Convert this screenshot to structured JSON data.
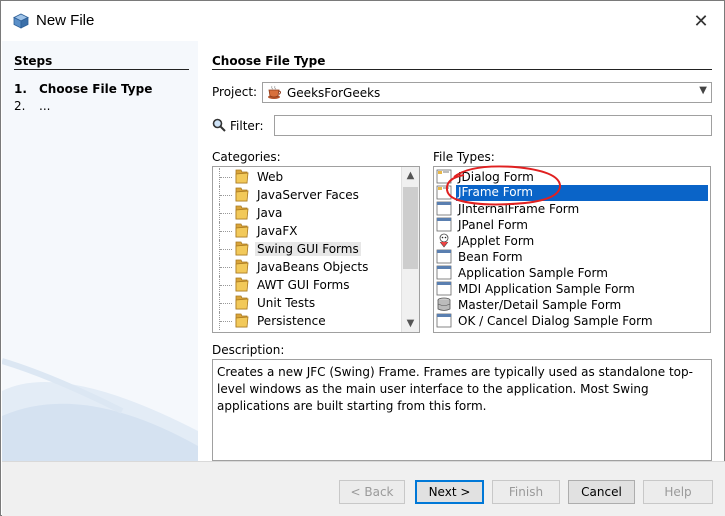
{
  "window": {
    "title": "New File",
    "close_glyph": "✕"
  },
  "steps": {
    "header": "Steps",
    "items": [
      {
        "num": "1.",
        "label": "Choose File Type"
      },
      {
        "num": "2.",
        "label": "..."
      }
    ]
  },
  "main": {
    "header": "Choose File Type",
    "project_label": "Project:",
    "project_value": "GeeksForGeeks",
    "filter_label": "Filter:",
    "filter_value": "",
    "categories_label": "Categories:",
    "file_types_label": "File Types:",
    "categories": [
      "Web",
      "JavaServer Faces",
      "Java",
      "JavaFX",
      "Swing GUI Forms",
      "JavaBeans Objects",
      "AWT GUI Forms",
      "Unit Tests",
      "Persistence"
    ],
    "selected_category": "Swing GUI Forms",
    "file_types": [
      "JDialog Form",
      "JFrame Form",
      "JInternalFrame Form",
      "JPanel Form",
      "JApplet Form",
      "Bean Form",
      "Application Sample Form",
      "MDI Application Sample Form",
      "Master/Detail Sample Form",
      "OK / Cancel Dialog Sample Form"
    ],
    "selected_file_type": "JFrame Form",
    "description_label": "Description:",
    "description_text": "Creates a new JFC (Swing) Frame. Frames are typically used as standalone top-level windows as the main user interface to the application. Most Swing applications are built starting from this form."
  },
  "buttons": {
    "back": "< Back",
    "next": "Next >",
    "finish": "Finish",
    "cancel": "Cancel",
    "help": "Help"
  },
  "colors": {
    "selection": "#0a64c8",
    "annotation_circle": "#e02020",
    "folder": "#e8b84a"
  }
}
